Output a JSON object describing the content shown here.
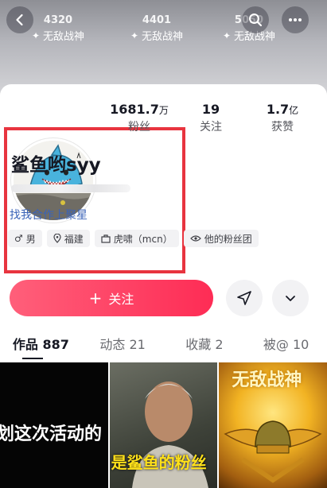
{
  "banner": {
    "stats": [
      {
        "value": "4320",
        "label": "无敌战神"
      },
      {
        "value": "4401",
        "label": "无敌战神"
      },
      {
        "value": "5050",
        "label": "无敌战神"
      }
    ]
  },
  "profile": {
    "name": "鲨鱼哟syy",
    "stats": [
      {
        "value": "1681.7",
        "unit": "万",
        "label": "粉丝"
      },
      {
        "value": "19",
        "unit": "",
        "label": "关注"
      },
      {
        "value": "1.7",
        "unit": "亿",
        "label": "获赞"
      }
    ],
    "link_text": "找我合作上聚星",
    "tags": [
      {
        "icon": "male-icon",
        "label": "男"
      },
      {
        "icon": "location-icon",
        "label": "福建"
      },
      {
        "icon": "mcn-icon",
        "label": "虎啸（mcn）"
      },
      {
        "icon": "fan-group-icon",
        "label": "他的粉丝团"
      }
    ]
  },
  "actions": {
    "follow_label": "关注"
  },
  "tabs": [
    {
      "label": "作品 887",
      "active": true
    },
    {
      "label": "动态 21",
      "active": false
    },
    {
      "label": "收藏 2",
      "active": false
    },
    {
      "label": "被@ 10",
      "active": false
    }
  ],
  "videos": [
    {
      "overlay_text": "划这次活动的"
    },
    {
      "overlay_text": "是鲨鱼的粉丝"
    },
    {
      "overlay_text": "无敌战神"
    }
  ],
  "colors": {
    "accent": "#fe2c55",
    "link": "#3a63b8",
    "highlight": "#e8343f"
  }
}
